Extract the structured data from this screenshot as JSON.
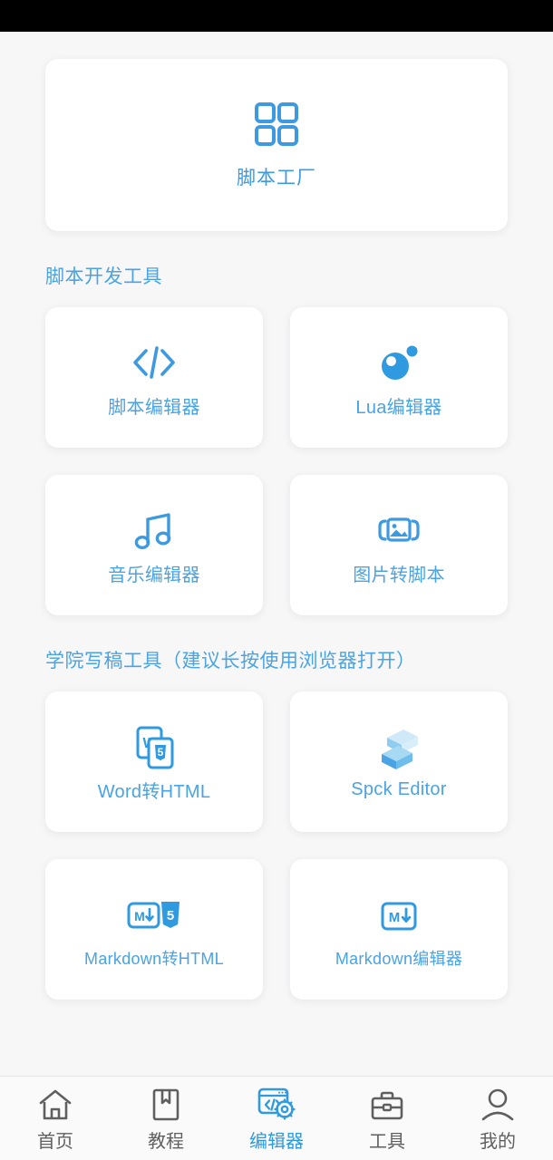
{
  "colors": {
    "accent": "#4aa3e3",
    "accent_dark": "#2f9ae0",
    "page_background": "#f7f7f8",
    "card_background": "#ffffff",
    "status_bar": "#000000",
    "nav_inactive": "#5f5f5f",
    "spck_light": "#bfe6f7",
    "spck_mid": "#7cc7ee",
    "spck_dark": "#4fa9e0"
  },
  "hero": {
    "label": "脚本工厂",
    "icon": "grid-four-squares-icon"
  },
  "sections": [
    {
      "header": "脚本开发工具",
      "rows": [
        [
          {
            "label": "脚本编辑器",
            "icon": "code-brackets-icon"
          },
          {
            "label": "Lua编辑器",
            "icon": "lua-moon-icon"
          }
        ],
        [
          {
            "label": "音乐编辑器",
            "icon": "music-note-icon"
          },
          {
            "label": "图片转脚本",
            "icon": "image-scan-icon"
          }
        ]
      ]
    },
    {
      "header": "学院写稿工具（建议长按使用浏览器打开）",
      "rows": [
        [
          {
            "label": "Word转HTML",
            "icon": "word-to-html-icon"
          },
          {
            "label": "Spck Editor",
            "icon": "spck-logo-icon"
          }
        ],
        [
          {
            "label": "Markdown转HTML",
            "icon": "markdown-to-html-icon"
          },
          {
            "label": "Markdown编辑器",
            "icon": "markdown-icon"
          }
        ]
      ]
    }
  ],
  "bottom_nav": {
    "items": [
      {
        "label": "首页",
        "icon": "home-icon",
        "active": false
      },
      {
        "label": "教程",
        "icon": "bookmark-book-icon",
        "active": false
      },
      {
        "label": "编辑器",
        "icon": "code-window-gear-icon",
        "active": true
      },
      {
        "label": "工具",
        "icon": "briefcase-icon",
        "active": false
      },
      {
        "label": "我的",
        "icon": "person-icon",
        "active": false
      }
    ]
  }
}
